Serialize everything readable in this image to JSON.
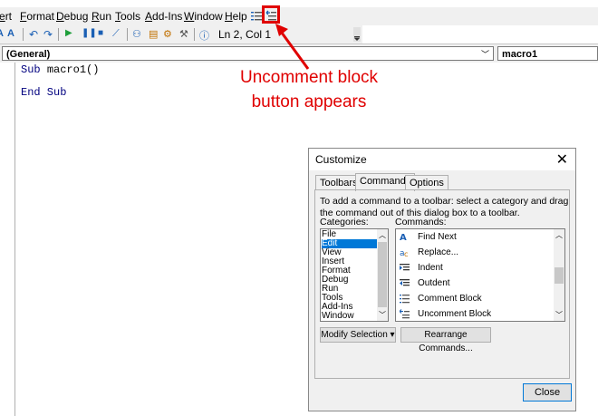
{
  "menubar": {
    "items": [
      "ert",
      "Format",
      "Debug",
      "Run",
      "Tools",
      "Add-Ins",
      "Window",
      "Help"
    ]
  },
  "toolbar": {
    "status": "Ln 2, Col 1",
    "highlighted_icon": "uncomment-block-icon"
  },
  "dropdowns": {
    "object": "(General)",
    "procedure": "macro1"
  },
  "code": {
    "line1_keyword": "Sub",
    "line1_name": "macro1()",
    "line2": "End Sub"
  },
  "annotation": {
    "line1": "Uncomment block",
    "line2": "button appears",
    "color": "#e00000"
  },
  "dialog": {
    "title": "Customize",
    "close": "✕",
    "tabs": [
      "Toolbars",
      "Commands",
      "Options"
    ],
    "active_tab": "Commands",
    "instruction": "To add a command to a toolbar: select a category and drag the command out of this dialog box to a toolbar.",
    "categories_label": "Categories:",
    "commands_label": "Commands:",
    "categories": [
      "File",
      "Edit",
      "View",
      "Insert",
      "Format",
      "Debug",
      "Run",
      "Tools",
      "Add-Ins",
      "Window"
    ],
    "selected_category": "Edit",
    "commands": [
      {
        "label": "Find Next",
        "icon": "find-next-icon"
      },
      {
        "label": "Replace...",
        "icon": "replace-icon"
      },
      {
        "label": "Indent",
        "icon": "indent-icon"
      },
      {
        "label": "Outdent",
        "icon": "outdent-icon"
      },
      {
        "label": "Comment Block",
        "icon": "comment-block-icon"
      },
      {
        "label": "Uncomment Block",
        "icon": "uncomment-block-icon"
      }
    ],
    "modify_selection": "Modify Selection ▾",
    "rearrange": "Rearrange Commands...",
    "close_button": "Close"
  }
}
